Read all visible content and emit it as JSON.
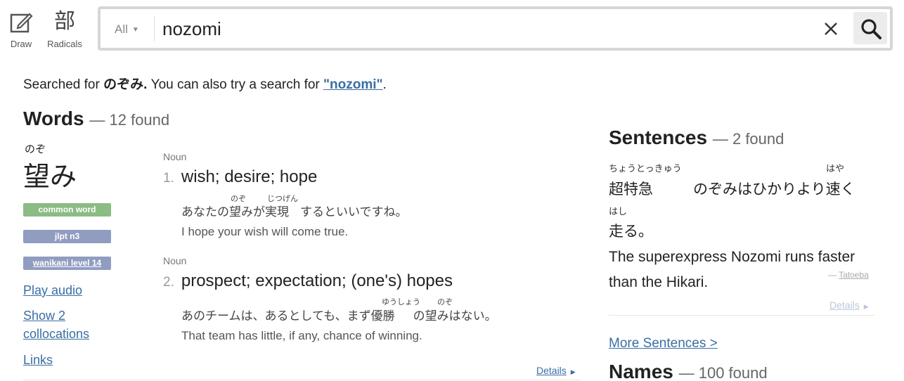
{
  "toolbar": {
    "draw_label": "Draw",
    "radicals_glyph": "部",
    "radicals_label": "Radicals"
  },
  "search": {
    "scope": "All",
    "query": "nozomi"
  },
  "searched": {
    "prefix": "Searched for ",
    "term": "のぞみ.",
    "middle": " You can also try a search for ",
    "alt_link": "\"nozomi\"",
    "suffix": "."
  },
  "words": {
    "heading": "Words",
    "count": "— 12 found",
    "furigana": "のぞ",
    "word": "望み",
    "tags": [
      "common word",
      "jlpt n3",
      "wanikani level 14"
    ],
    "links": [
      "Play audio",
      "Show 2 collocations",
      "Links"
    ],
    "meanings": [
      {
        "pos": "Noun",
        "num": "1.",
        "text": "wish; desire; hope",
        "example_jp_parts": [
          "あなたの",
          "望み",
          "が",
          "実現",
          "するといいですね。"
        ],
        "example_rubies": [
          "のぞ",
          "じつげん"
        ],
        "example_en": "I hope your wish will come true."
      },
      {
        "pos": "Noun",
        "num": "2.",
        "text": "prospect; expectation; (one's) hopes",
        "example_jp_parts": [
          "あのチームは、あるとしても、まず",
          "優勝",
          "の",
          "望み",
          "はない。"
        ],
        "example_rubies": [
          "ゆうしょう",
          "のぞ"
        ],
        "example_en": "That team has little, if any, chance of winning."
      }
    ],
    "details_label": "Details"
  },
  "sentences": {
    "heading": "Sentences",
    "count": "— 2 found",
    "line1_parts": [
      "超特急",
      "のぞみはひかりより",
      "速",
      "く"
    ],
    "line1_rubies": [
      "ちょうとっきゅう",
      "はや"
    ],
    "line2_parts": [
      "走",
      "る。"
    ],
    "line2_ruby": "はし",
    "english": "The superexpress Nozomi runs faster than the Hikari.",
    "source_dash": "— ",
    "source": "Tatoeba",
    "details_label": "Details",
    "more_label": "More Sentences >"
  },
  "names": {
    "heading": "Names",
    "count": "— 100 found"
  },
  "colors": {
    "link": "#3a6ea5",
    "common_tag": "#8abc83",
    "jlpt_tag": "#909dc0"
  }
}
